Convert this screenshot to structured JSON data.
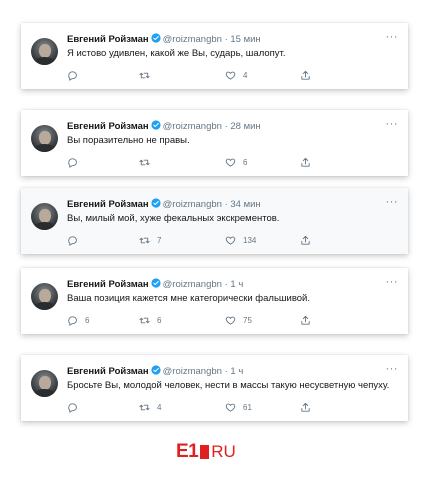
{
  "colors": {
    "accent": "#1da1f2",
    "text_primary": "#14171a",
    "text_secondary": "#657786",
    "logo_red": "#e02121"
  },
  "tweets": [
    {
      "author": "Евгений Ройзман",
      "handle": "@roizmangbn",
      "separator": "·",
      "time": "15 мин",
      "text": "Я истово удивлен, какой же Вы, сударь, шалопут.",
      "replies": "",
      "retweets": "",
      "likes": "4",
      "more": "···"
    },
    {
      "author": "Евгений Ройзман",
      "handle": "@roizmangbn",
      "separator": "·",
      "time": "28 мин",
      "text": "Вы поразительно не правы.",
      "replies": "",
      "retweets": "",
      "likes": "6",
      "more": "···"
    },
    {
      "author": "Евгений Ройзман",
      "handle": "@roizmangbn",
      "separator": "·",
      "time": "34 мин",
      "text": "Вы, милый мой, хуже фекальных экскрементов.",
      "replies": "",
      "retweets": "7",
      "likes": "134",
      "more": "···"
    },
    {
      "author": "Евгений Ройзман",
      "handle": "@roizmangbn",
      "separator": "·",
      "time": "1 ч",
      "text": "Ваша позиция кажется мне категорически фальшивой.",
      "replies": "6",
      "retweets": "6",
      "likes": "75",
      "more": "···"
    },
    {
      "author": "Евгений Ройзман",
      "handle": "@roizmangbn",
      "separator": "·",
      "time": "1 ч",
      "text": "Бросьте Вы, молодой человек, нести в массы такую несусветную чепуху.",
      "replies": "",
      "retweets": "4",
      "likes": "61",
      "more": "···"
    }
  ],
  "logo": {
    "left": "E1",
    "right": "RU"
  },
  "icons": [
    "reply-icon",
    "retweet-icon",
    "like-icon",
    "share-icon",
    "verified-icon",
    "more-icon"
  ]
}
